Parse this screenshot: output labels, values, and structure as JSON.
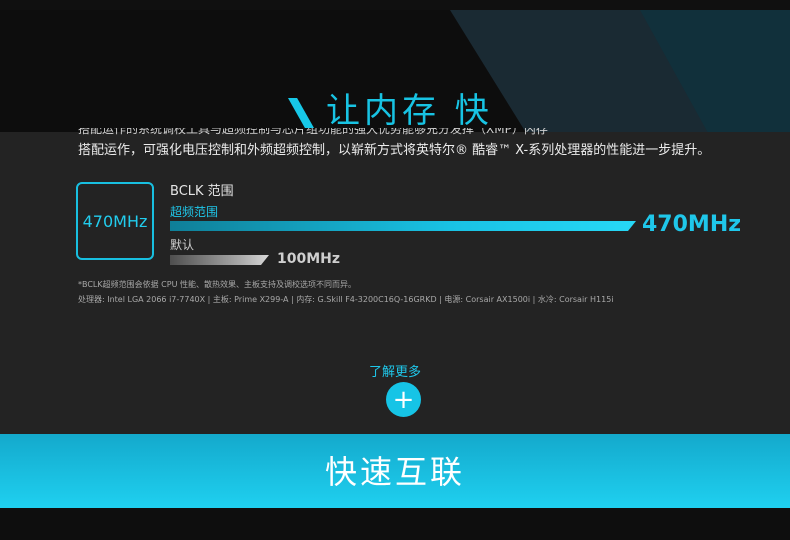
{
  "hero": {
    "title": "让内存 快"
  },
  "intro": {
    "cut_line": "搭配运作的系统调校工具与超频控制与芯片组功能的强大优势能够充分发挥（XMP）内存",
    "text": "搭配运作，可强化电压控制和外频超频控制，以崭新方式将英特尔® 酷睿™ X-系列处理器的性能进一步提升。"
  },
  "freq_badge": {
    "label": "470MHz"
  },
  "chart_data": {
    "type": "bar",
    "title": "BCLK 范围",
    "orientation": "horizontal",
    "unit": "MHz",
    "series": [
      {
        "name": "超频范围",
        "value": 470,
        "value_label": "470MHz",
        "color": "#1fc7ea"
      },
      {
        "name": "默认",
        "value": 100,
        "value_label": "100MHz",
        "color": "#cfcfcf"
      }
    ],
    "xlim": [
      0,
      470
    ],
    "grid": false
  },
  "footnotes": {
    "line1": "*BCLK超频范围会依据 CPU 性能、散热效果、主板支持及调校选项不同而异。",
    "line2": "处理器: Intel LGA 2066 i7-7740X | 主板: Prime X299-A | 内存: G.Skill F4-3200C16Q-16GRKD | 电源: Corsair AX1500i | 水冷: Corsair H115i"
  },
  "learn_more": {
    "label": "了解更多",
    "button_icon": "plus-icon",
    "button_glyph": "+"
  },
  "next_section": {
    "title": "快速互联"
  },
  "colors": {
    "accent": "#1fc7ea",
    "background": "#232323"
  }
}
